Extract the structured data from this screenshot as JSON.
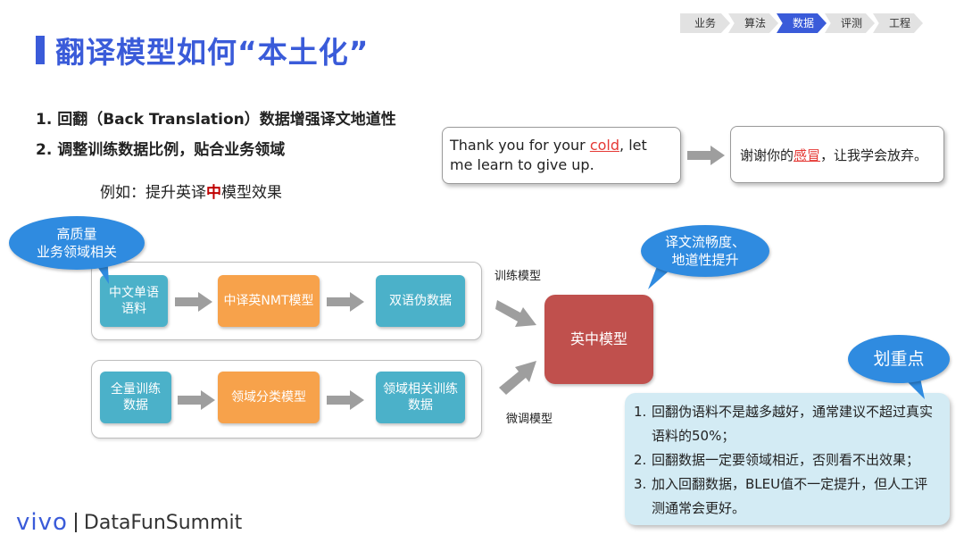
{
  "title": "翻译模型如何“本土化”",
  "breadcrumbs": [
    {
      "label": "业务",
      "active": false
    },
    {
      "label": "算法",
      "active": false
    },
    {
      "label": "数据",
      "active": true
    },
    {
      "label": "评测",
      "active": false
    },
    {
      "label": "工程",
      "active": false
    }
  ],
  "points": [
    "1. 回翻（Back Translation）数据增强译文地道性",
    "2. 调整训练数据比例，贴合业务领域"
  ],
  "example": {
    "prefix": "例如：提升英译",
    "highlight": "中",
    "suffix": "模型效果"
  },
  "translation": {
    "en_before": "Thank you for your ",
    "en_highlight": "cold",
    "en_after": ", let me learn to give up.",
    "zh_before": "谢谢你的",
    "zh_highlight": "感冒",
    "zh_after": "，让我学会放弃。"
  },
  "bubbles": {
    "quality": "高质量\n业务领域相关",
    "fluency": "译文流畅度、\n地道性提升",
    "key": "划重点"
  },
  "flow": {
    "row1": [
      "中文单语\n语料",
      "中译英NMT模型",
      "双语伪数据"
    ],
    "row2": [
      "全量训练\n数据",
      "领域分类模型",
      "领域相关训练\n数据"
    ],
    "center": "英中模型",
    "train_label": "训练模型",
    "finetune_label": "微调模型"
  },
  "key_points": [
    {
      "num": "1.",
      "text": "回翻伪语料不是越多越好，通常建议不超过真实语料的50%；"
    },
    {
      "num": "2.",
      "text": "回翻数据一定要领域相近，否则看不出效果；"
    },
    {
      "num": "3.",
      "text": "加入回翻数据，BLEU值不一定提升，但人工评测通常会更好。"
    }
  ],
  "footer": {
    "brand": "vivo",
    "event": "DataFunSummit"
  },
  "colors": {
    "accent": "#3a5bd9",
    "teal": "#4bb1c9",
    "orange": "#f7a24b",
    "red": "#c0504d",
    "bubble": "#2f8be0",
    "highlight": "#e53935"
  }
}
